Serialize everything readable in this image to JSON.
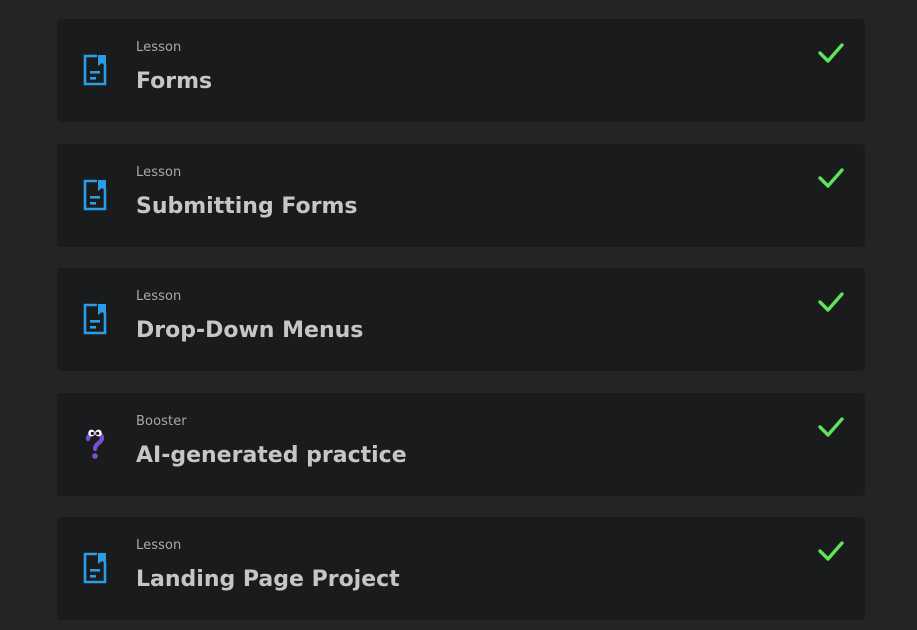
{
  "colors": {
    "background": "#232425",
    "card": "#1a1b1d",
    "lesson_icon": "#2a9de6",
    "booster_icon": "#7b4fd1",
    "check": "#5fe35a",
    "title": "#c8c6c2",
    "kind": "#a9a9a9"
  },
  "items": [
    {
      "kind": "Lesson",
      "title": "Forms",
      "icon": "lesson-document-icon",
      "completed": true
    },
    {
      "kind": "Lesson",
      "title": "Submitting Forms",
      "icon": "lesson-document-icon",
      "completed": true
    },
    {
      "kind": "Lesson",
      "title": "Drop-Down Menus",
      "icon": "lesson-document-icon",
      "completed": true
    },
    {
      "kind": "Booster",
      "title": "AI-generated practice",
      "icon": "question-mark-mascot-icon",
      "completed": true
    },
    {
      "kind": "Lesson",
      "title": "Landing Page Project",
      "icon": "lesson-document-icon",
      "completed": true
    }
  ]
}
